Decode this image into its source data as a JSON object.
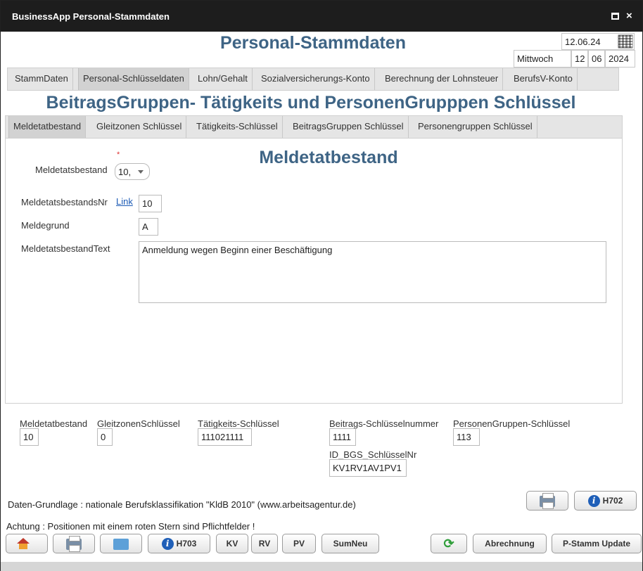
{
  "window": {
    "title": "BusinessApp Personal-Stammdaten",
    "maximize_icon": "maximize-icon",
    "close_label": "×"
  },
  "header": {
    "title": "Personal-Stammdaten",
    "date": "12.06.24",
    "weekday": "Mittwoch",
    "day": "12",
    "month": "06",
    "year": "2024"
  },
  "main_tabs": [
    {
      "label": "StammDaten"
    },
    {
      "label": "Personal-Schlüsseldaten",
      "active": true
    },
    {
      "label": "Lohn/Gehalt"
    },
    {
      "label": "Sozialversicherungs-Konto"
    },
    {
      "label": "Berechnung der Lohnsteuer"
    },
    {
      "label": "BerufsV-Konto"
    }
  ],
  "section_title": "BeitragsGruppen- Tätigkeits und PersonenGrupppen Schlüssel",
  "sub_tabs": [
    {
      "label": "Meldetatbestand",
      "active": true
    },
    {
      "label": "Gleitzonen Schlüssel"
    },
    {
      "label": "Tätigkeits-Schlüssel"
    },
    {
      "label": "BeitragsGruppen Schlüssel"
    },
    {
      "label": "Personengruppen Schlüssel"
    }
  ],
  "form": {
    "panel_title": "Meldetatbestand",
    "required_marker": "*",
    "meldetatsbestand_label": "Meldetatsbestand",
    "meldetatsbestand_value": "10,",
    "nr_label": "MeldetatsbestandsNr",
    "link_label": "Link",
    "nr_value": "10",
    "grund_label": "Meldegrund",
    "grund_value": "A",
    "text_label": "MeldetatsbestandText",
    "text_value": "Anmeldung wegen Beginn einer Beschäftigung"
  },
  "summary": {
    "meldetatbestand_label": "Meldetatbestand",
    "meldetatbestand_value": "10",
    "gleitzonen_label": "GleitzonenSchlüssel",
    "gleitzonen_value": "0",
    "taetigkeits_label": "Tätigkeits-Schlüssel",
    "taetigkeits_value": "111021111",
    "beitrags_label": "Beitrags-Schlüsselnummer",
    "beitrags_value": "1111",
    "personengruppen_label": "PersonenGruppen-Schlüssel",
    "personengruppen_value": "113",
    "id_bgs_label": "ID_BGS_SchlüsselNr",
    "id_bgs_value": "KV1RV1AV1PV1"
  },
  "footnote": "Daten-Grundlage : nationale Berufsklassifikation \"KldB 2010\" (www.arbeitsagentur.de)",
  "warning": "Achtung : Positionen mit einem roten Stern sind Pflichtfelder !",
  "buttons": {
    "h702": "H702",
    "h703": "H703",
    "kv": "KV",
    "rv": "RV",
    "pv": "PV",
    "sumneu": "SumNeu",
    "abrechnung": "Abrechnung",
    "pstamm": "P-Stamm Update",
    "info_glyph": "i"
  }
}
